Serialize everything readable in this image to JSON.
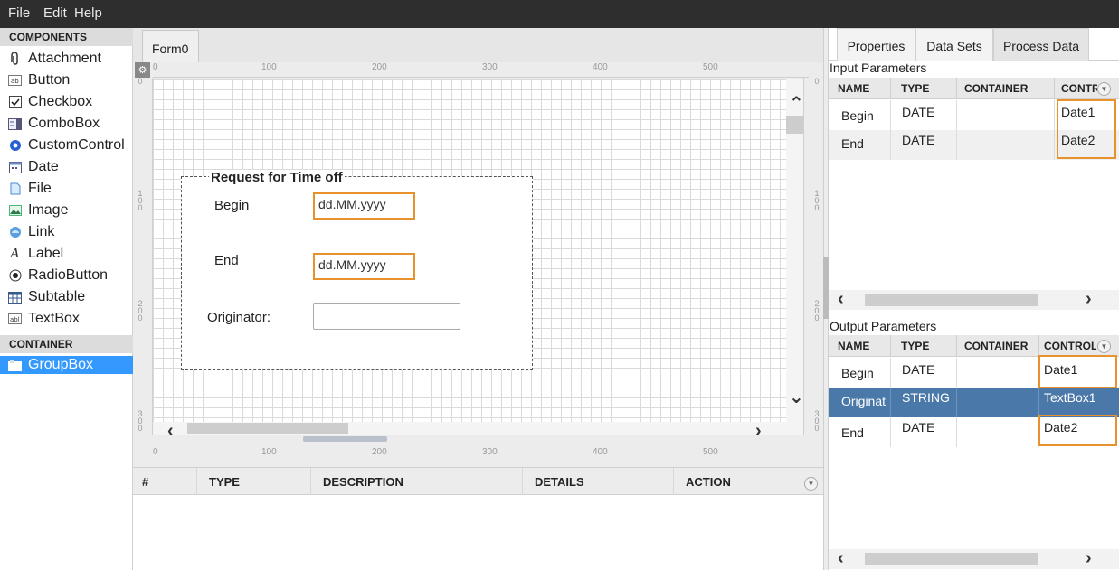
{
  "menu": [
    "File",
    "Edit",
    "Help"
  ],
  "components": {
    "header": "COMPONENTS",
    "items": [
      "Attachment",
      "Button",
      "Checkbox",
      "ComboBox",
      "CustomControl",
      "Date",
      "File",
      "Image",
      "Link",
      "Label",
      "RadioButton",
      "Subtable",
      "TextBox"
    ],
    "icons": [
      "paperclip-icon",
      "button-icon",
      "checkbox-icon",
      "combobox-icon",
      "gear-icon",
      "calendar-icon",
      "file-icon",
      "image-icon",
      "link-icon",
      "label-icon",
      "radio-icon",
      "table-icon",
      "textbox-icon"
    ],
    "container_header": "CONTAINER",
    "container_items": [
      "GroupBox"
    ]
  },
  "designer": {
    "tab": "Form0",
    "ruler_top": [
      "0",
      "100",
      "200",
      "300",
      "400",
      "500"
    ],
    "ruler_left": [
      "0",
      "100",
      "200",
      "300"
    ],
    "groupbox": {
      "title": "Request for Time off",
      "begin_label": "Begin",
      "begin_value": "dd.MM.yyyy",
      "end_label": "End",
      "end_value": "dd.MM.yyyy",
      "originator_label": "Originator:",
      "originator_value": ""
    }
  },
  "messages": {
    "columns": [
      "#",
      "TYPE",
      "DESCRIPTION",
      "DETAILS",
      "ACTION"
    ]
  },
  "right_panel": {
    "tabs": [
      "Properties",
      "Data Sets",
      "Process Data"
    ],
    "active_tab": "Process Data",
    "input": {
      "title": "Input Parameters",
      "columns": [
        "NAME",
        "TYPE",
        "CONTAINER",
        "CONTR"
      ],
      "rows": [
        {
          "name": "Begin",
          "type": "DATE",
          "container": "",
          "control": "Date1"
        },
        {
          "name": "End",
          "type": "DATE",
          "container": "",
          "control": "Date2"
        }
      ]
    },
    "output": {
      "title": "Output Parameters",
      "columns": [
        "NAME",
        "TYPE",
        "CONTAINER",
        "CONTROL"
      ],
      "rows": [
        {
          "name": "Begin",
          "type": "DATE",
          "container": "",
          "control": "Date1"
        },
        {
          "name": "Originat",
          "type": "STRING",
          "container": "",
          "control": "TextBox1"
        },
        {
          "name": "End",
          "type": "DATE",
          "container": "",
          "control": "Date2"
        }
      ]
    }
  },
  "colors": {
    "menubar": "#2e2e2e",
    "highlight": "#e8922e",
    "selection": "#3399ff",
    "selected_row": "#4a78a8"
  }
}
